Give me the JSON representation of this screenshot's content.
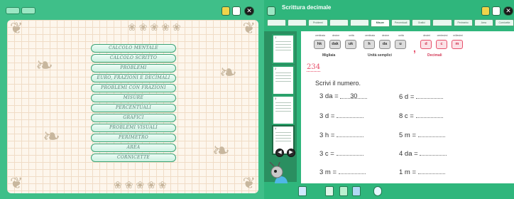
{
  "left_panel": {
    "top_buttons": [
      "",
      ""
    ],
    "menu": [
      "CALCOLO MENTALE",
      "CALCOLO SCRITTO",
      "PROBLEMI",
      "EURO, FRAZIONI E DECIMALI",
      "PROBLEMI CON FRAZIONI",
      "MISURE",
      "PERCENTUALI",
      "GRAFICI",
      "PROBLEMI VISUALI",
      "PERIMETRO",
      "AREA",
      "CORNICETTE"
    ]
  },
  "right_panel": {
    "title": "Scrittura decimale",
    "tabs": [
      "",
      "",
      "Problemi",
      "",
      "",
      "Misure",
      "Percentuali",
      "Grafici",
      "",
      "Perimetro",
      "Area",
      "Cornicette"
    ],
    "active_tab_index": 5,
    "thumbnails": [
      {
        "num": "1"
      },
      {
        "num": "2"
      },
      {
        "num": "3"
      },
      {
        "num": "4"
      }
    ],
    "place_values": {
      "groups": [
        {
          "captions": [
            "centinaia",
            "decine",
            "unità"
          ],
          "boxes": [
            "hk",
            "dak",
            "uk"
          ],
          "label": "Migliaia",
          "style": "gray"
        },
        {
          "captions": [
            "centinaia",
            "decine",
            "unità"
          ],
          "boxes": [
            "h",
            "da",
            "u"
          ],
          "label": "Unità semplici",
          "style": "gray"
        },
        {
          "captions": [
            "decimi",
            "centesimi",
            "millesimi"
          ],
          "boxes": [
            "d",
            "c",
            "m"
          ],
          "label": "Decimali",
          "style": "pink"
        }
      ],
      "comma": ","
    },
    "example_number": "234",
    "instruction": "Scrivi il numero.",
    "exercises": [
      {
        "prompt": "3 da =",
        "answer": "30"
      },
      {
        "prompt": "6 d =",
        "answer": ""
      },
      {
        "prompt": "3 d =",
        "answer": ""
      },
      {
        "prompt": "8 c =",
        "answer": ""
      },
      {
        "prompt": "3 h =",
        "answer": ""
      },
      {
        "prompt": "5 m =",
        "answer": ""
      },
      {
        "prompt": "3 c =",
        "answer": ""
      },
      {
        "prompt": "4 da =",
        "answer": ""
      },
      {
        "prompt": "3 m =",
        "answer": ""
      },
      {
        "prompt": "1 m =",
        "answer": ""
      }
    ]
  },
  "colors": {
    "panel_green": "#3fbf89",
    "accent_pink": "#e7506b",
    "paper": "#fdf6ec"
  }
}
